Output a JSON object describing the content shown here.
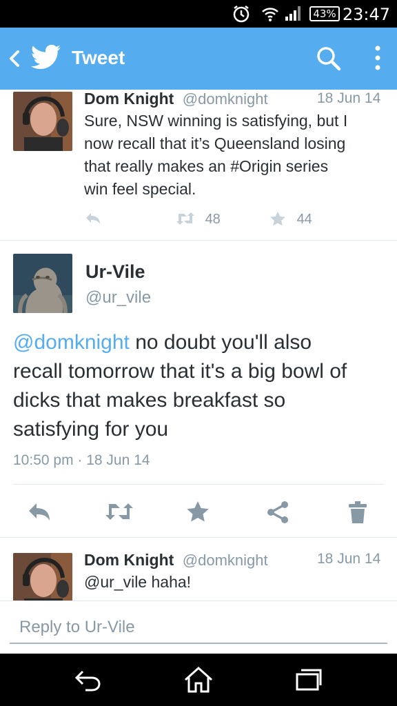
{
  "status_bar": {
    "battery": "43%",
    "time": "23:47"
  },
  "app_bar": {
    "title": "Tweet"
  },
  "tweets": [
    {
      "name": "Dom Knight",
      "handle": "@domknight",
      "date": "18 Jun 14",
      "text_lines": [
        "Sure, NSW winning is satisfying, but I",
        "now recall that it’s Queensland losing",
        "that really makes an #Origin series",
        "win feel special."
      ],
      "retweets": "48",
      "favorites": "44"
    },
    {
      "name": "Ur-Vile",
      "handle": "@ur_vile",
      "mention": "@domknight",
      "text_lines": [
        " no doubt you'll also",
        "recall tomorrow that it's a big bowl of",
        "dicks that makes breakfast so",
        "satisfying for you"
      ],
      "timestamp": "10:50 pm · 18 Jun 14"
    },
    {
      "name": "Dom Knight",
      "handle": "@domknight",
      "date": "18 Jun 14",
      "text": "@ur_vile haha!"
    }
  ],
  "composer": {
    "placeholder": "Reply to Ur-Vile"
  },
  "colors": {
    "app_bar": "#55acee",
    "link": "#55acee",
    "muted": "#8899a6"
  }
}
